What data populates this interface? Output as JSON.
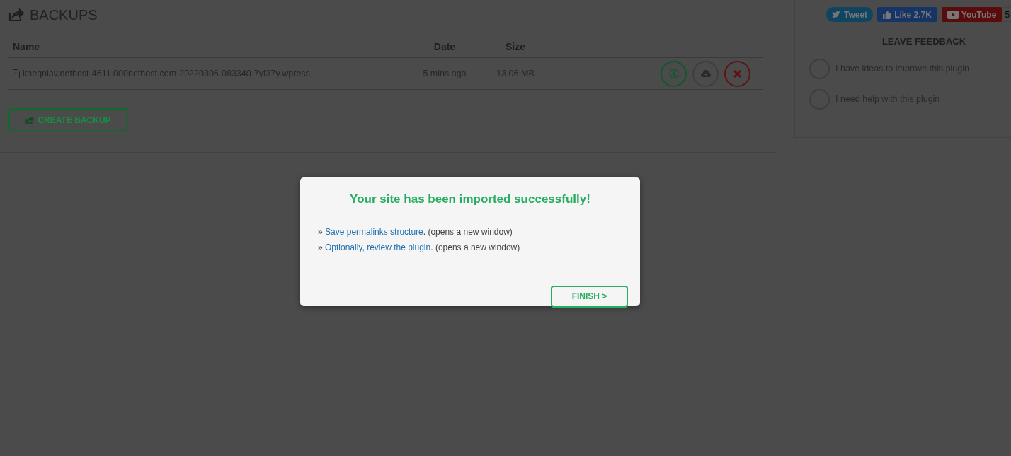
{
  "backups": {
    "title": "BACKUPS",
    "columns": [
      "Name",
      "Date",
      "Size"
    ],
    "rows": [
      {
        "name": "kaeqnlav.nethost-4611.000nethost.com-20220306-083340-7yf37y.wpress",
        "date": "5 mins ago",
        "size": "13.06 MB",
        "actions": [
          {
            "kind": "download"
          },
          {
            "kind": "upload"
          },
          {
            "kind": "delete"
          }
        ]
      }
    ],
    "create_button": "CREATE BACKUP"
  },
  "social": [
    {
      "kind": "tweet",
      "label": "Tweet"
    },
    {
      "kind": "like",
      "label": "Like 2.7K"
    },
    {
      "kind": "youtube",
      "label": "YouTube",
      "count": "5"
    }
  ],
  "feedback": {
    "title": "LEAVE FEEDBACK",
    "options": [
      {
        "label": "I have ideas to improve this plugin",
        "selected": false
      },
      {
        "label": "I need help with this plugin",
        "selected": false
      }
    ]
  },
  "modal": {
    "title": "Your site has been imported successfully!",
    "lines": [
      {
        "prefix": "»",
        "link": "Save permalinks structure",
        "suffix": ". (opens a new window)"
      },
      {
        "prefix": "»",
        "link": "Optionally, review the plugin",
        "suffix": ". (opens a new window)"
      }
    ],
    "button": "FINISH >"
  }
}
